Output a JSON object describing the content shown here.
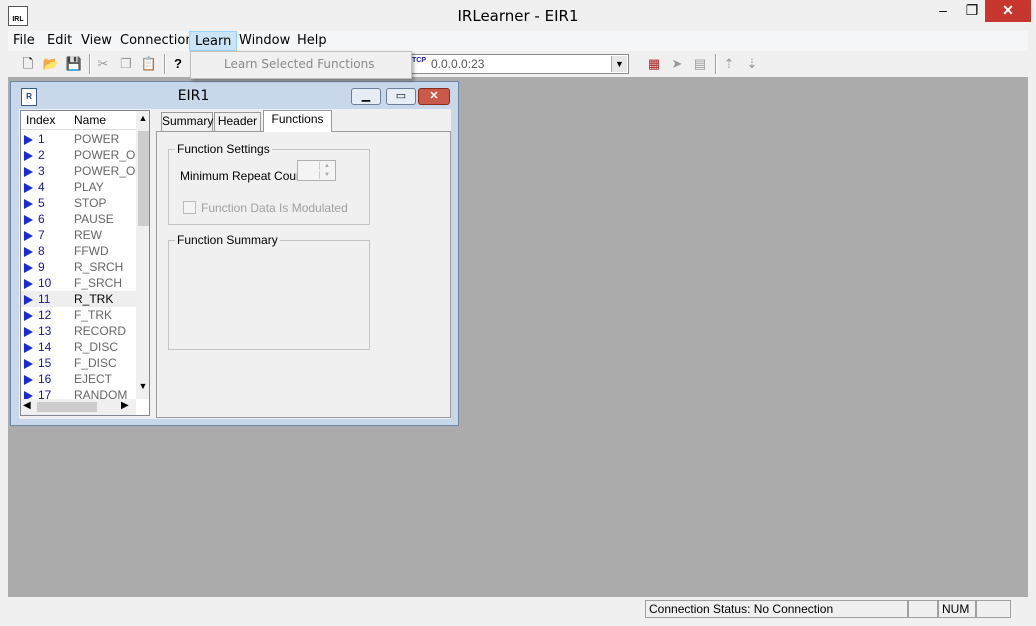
{
  "window": {
    "title": "IRLearner - EIR1",
    "app_icon_text": "IRL",
    "min": "–",
    "max": "❐",
    "close": "✕"
  },
  "menu": [
    "File",
    "Edit",
    "View",
    "Connection",
    "Learn",
    "Window",
    "Help"
  ],
  "learn_menu": {
    "selected_item": "Learn Selected Functions"
  },
  "toolbar": {
    "icons": [
      "new-icon",
      "open-icon",
      "save-icon",
      "cut-icon",
      "copy-icon",
      "paste-icon",
      "help-icon",
      "device-icon",
      "send-icon",
      "transfer-icon",
      "upload-icon",
      "download-icon"
    ],
    "connection_address": "0.0.0.0:23",
    "tcp_label": "TCP"
  },
  "child": {
    "title": "EIR1",
    "list": {
      "headers": {
        "index": "Index",
        "name": "Name"
      },
      "rows": [
        {
          "index": "1",
          "name": "POWER"
        },
        {
          "index": "2",
          "name": "POWER_ON"
        },
        {
          "index": "3",
          "name": "POWER_OFF"
        },
        {
          "index": "4",
          "name": "PLAY"
        },
        {
          "index": "5",
          "name": "STOP"
        },
        {
          "index": "6",
          "name": "PAUSE"
        },
        {
          "index": "7",
          "name": "REW"
        },
        {
          "index": "8",
          "name": "FFWD"
        },
        {
          "index": "9",
          "name": "R_SRCH"
        },
        {
          "index": "10",
          "name": "F_SRCH"
        },
        {
          "index": "11",
          "name": "R_TRK"
        },
        {
          "index": "12",
          "name": "F_TRK"
        },
        {
          "index": "13",
          "name": "RECORD"
        },
        {
          "index": "14",
          "name": "R_DISC"
        },
        {
          "index": "15",
          "name": "F_DISC"
        },
        {
          "index": "16",
          "name": "EJECT"
        },
        {
          "index": "17",
          "name": "RANDOM"
        }
      ],
      "selected_index": "11"
    },
    "tabs": {
      "summary": "Summary",
      "header": "Header",
      "functions": "Functions"
    },
    "function_settings": {
      "label": "Function Settings",
      "repeat_label": "Minimum Repeat Count",
      "modulated_label": "Function Data Is Modulated"
    },
    "function_summary": {
      "label": "Function Summary"
    }
  },
  "status": {
    "connection": "Connection Status: No Connection",
    "num": "NUM"
  }
}
